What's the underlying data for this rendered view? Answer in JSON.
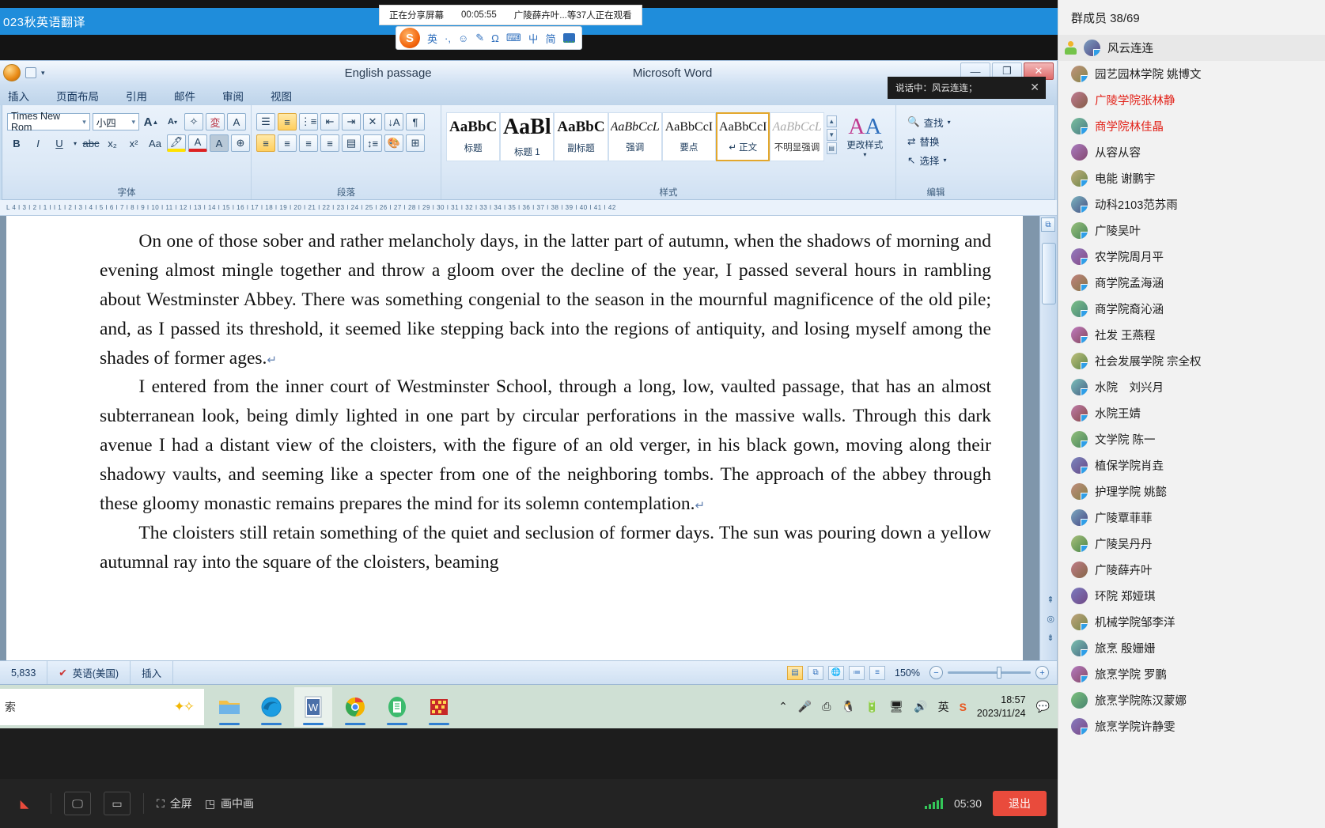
{
  "meeting": {
    "title": "023秋英语翻译",
    "share_toast": {
      "status": "正在分享屏幕",
      "timer": "00:05:55",
      "viewers": "广陵薛卉叶...等37人正在观看"
    },
    "speaking_toast": {
      "text": "说话中：风云连连；",
      "close": "✕"
    },
    "bottom_bar": {
      "share_screen_icon": "share-screen-icon",
      "whiteboard_icon": "whiteboard-icon",
      "fullscreen_label": "全屏",
      "pip_label": "画中画",
      "duration": "05:30",
      "quit_label": "退出"
    }
  },
  "word": {
    "title_doc": "English passage",
    "title_app": "Microsoft Word",
    "window_buttons": {
      "minimize": "—",
      "restore": "❐",
      "close": "✕"
    },
    "qat": {
      "office_orb": "office-orb-icon",
      "save": "save-icon",
      "undo": "undo-icon",
      "customize": "customize-icon"
    },
    "tabs": [
      "插入",
      "页面布局",
      "引用",
      "邮件",
      "审阅",
      "视图"
    ],
    "font_group": {
      "name": "字体",
      "font_family": "Times New Rom",
      "font_size": "小四",
      "grow": "A",
      "shrink": "A",
      "clear_format": "clear-format-icon",
      "phonetic": "phonetic-guide-icon",
      "char_border": "character-border-icon",
      "bold": "B",
      "italic": "I",
      "underline": "U",
      "strike": "abc",
      "subscript": "x₂",
      "superscript": "x²",
      "change_case": "Aa",
      "highlight": "highlight-color-icon",
      "font_color": "font-color-icon",
      "shading": "A",
      "enclose": "enclose-character-icon"
    },
    "paragraph_group": {
      "name": "段落",
      "bullets": "bullet-list-icon",
      "numbering": "numbered-list-icon",
      "multilevel": "multilevel-list-icon",
      "dec_indent": "decrease-indent-icon",
      "inc_indent": "increase-indent-icon",
      "asian_layout": "asian-layout-icon",
      "sort": "sort-icon",
      "show_marks": "show-formatting-marks-icon",
      "align_left": "align-left-icon",
      "align_center": "align-center-icon",
      "align_right": "align-right-icon",
      "justify": "justify-icon",
      "distribute": "distributed-icon",
      "line_spacing": "line-spacing-icon",
      "shading": "paragraph-shading-icon",
      "borders": "borders-icon"
    },
    "styles_group": {
      "name": "样式",
      "items": [
        {
          "preview": "AaBbC",
          "label": "标题",
          "variant": "serif-bold"
        },
        {
          "preview": "AaBl",
          "label": "标题 1",
          "variant": "serif-bold-big"
        },
        {
          "preview": "AaBbC",
          "label": "副标题",
          "variant": "serif-bold"
        },
        {
          "preview": "AaBbCcL",
          "label": "强调",
          "variant": "serif-italic"
        },
        {
          "preview": "AaBbCcI",
          "label": "要点",
          "variant": "serif"
        },
        {
          "preview": "AaBbCcI",
          "label": "正文",
          "variant": "serif",
          "active": true,
          "mark": "↵ "
        },
        {
          "preview": "AaBbCcL",
          "label": "不明显强调",
          "variant": "serif-italic-dim"
        }
      ],
      "change_styles_label": "更改样式",
      "scroll_up": "▲",
      "scroll_down": "▼",
      "more": "▤"
    },
    "editing_group": {
      "name": "编辑",
      "find": "查找",
      "replace": "替换",
      "select": "选择"
    },
    "ruler": "L  4  I  3  I  2  I  1  I      I  1  I  2  I  3  I  4  I  5  I  6  I  7  I  8  I  9  I  10  I  11  I  12  I  13  I  14  I  15  I  16  I  17  I  18  I  19  I  20  I  21  I  22  I  23  I  24  I  25  I  26  I  27  I  28  I  29  I  30  I  31  I  32  I  33  I  34  I  35  I  36  I  37  I  38  I  39  I  40  I  41  I  42",
    "document": {
      "paragraphs": [
        "On one of those sober and rather melancholy days, in the latter part of autumn, when the shadows of morning and evening almost mingle together and throw a gloom over the decline of the year, I passed several hours in rambling about Westminster Abbey. There was something congenial to the season in the mournful magnificence of the old pile; and, as I passed its threshold, it seemed like stepping back into the regions of antiquity, and losing myself among the shades of former ages.",
        "I entered from the inner court of Westminster School, through a long, low, vaulted passage, that has an almost subterranean look, being dimly lighted in one part by circular perforations in the massive walls. Through this dark avenue I had a distant view of the cloisters, with the figure of an old verger, in his black gown, moving along their shadowy vaults, and seeming like a specter from one of the neighboring tombs. The approach of the abbey through these gloomy monastic remains prepares the mind for its solemn contemplation.",
        "The cloisters still retain something of the quiet and seclusion of former days. The sun was pouring down a yellow autumnal ray into the square of the cloisters, beaming"
      ],
      "pilcrow": "↵"
    },
    "status_bar": {
      "word_count": "5,833",
      "proofing_icon": "proofing-errors-icon",
      "language": "英语(美国)",
      "insert_mode": "插入",
      "views": [
        "print-layout-icon",
        "full-screen-reading-icon",
        "web-layout-icon",
        "outline-icon",
        "draft-icon"
      ],
      "zoom": "150%",
      "zoom_out": "−",
      "zoom_in": "+"
    }
  },
  "ime": {
    "name": "sogou-ime-toolbar",
    "logo": "S",
    "items": [
      "英",
      "·,",
      "☺",
      "✎",
      "Ω",
      "⌨",
      "屮",
      "简",
      "▦"
    ]
  },
  "taskbar": {
    "search_placeholder": "索",
    "copilot_icon": "copilot-sparkle-icon",
    "apps": [
      "file-explorer-icon",
      "edge-icon",
      "word-icon",
      "chrome-icon",
      "wps-doc-icon",
      "winrar-icon"
    ],
    "tray": [
      "show-hidden-icons-chevron",
      "microphone-icon",
      "screen-record-icon",
      "qq-penguin-icon",
      "battery-icon",
      "network-icon",
      "volume-icon",
      "ime-english-icon",
      "sogou-icon"
    ],
    "time": "18:57",
    "date": "2023/11/24",
    "notification_icon": "notification-icon"
  },
  "members": {
    "header": "群成员 38/69",
    "list": [
      {
        "name": "风云连连",
        "host": true,
        "highlight": true
      },
      {
        "name": "园艺园林学院 姚博文"
      },
      {
        "name": "广陵学院张林静",
        "red": true
      },
      {
        "name": "商学院林佳晶",
        "red": true
      },
      {
        "name": "从容从容"
      },
      {
        "name": "电能 谢鹏宇"
      },
      {
        "name": "动科2103范苏雨"
      },
      {
        "name": "广陵吴叶"
      },
      {
        "name": "农学院周月平"
      },
      {
        "name": "商学院孟海涵"
      },
      {
        "name": "商学院裔沁涵"
      },
      {
        "name": "社发 王燕程"
      },
      {
        "name": "社会发展学院 宗全权"
      },
      {
        "name": "水院　刘兴月"
      },
      {
        "name": "水院王婧"
      },
      {
        "name": "文学院 陈一"
      },
      {
        "name": "植保学院肖垚"
      },
      {
        "name": "护理学院 姚懿"
      },
      {
        "name": "广陵覃菲菲"
      },
      {
        "name": "广陵吴丹丹"
      },
      {
        "name": "广陵薛卉叶"
      },
      {
        "name": "环院 郑娅琪"
      },
      {
        "name": "机械学院邹李洋"
      },
      {
        "name": "旅烹 殷姗姗"
      },
      {
        "name": "旅烹学院 罗鹏"
      },
      {
        "name": "旅烹学院陈汉蒙娜"
      },
      {
        "name": "旅烹学院许静雯"
      }
    ]
  },
  "colors": {
    "accent": "#1f8ddb",
    "red": "#e2231a",
    "quit": "#e94b3c",
    "signal": "#34c759"
  }
}
